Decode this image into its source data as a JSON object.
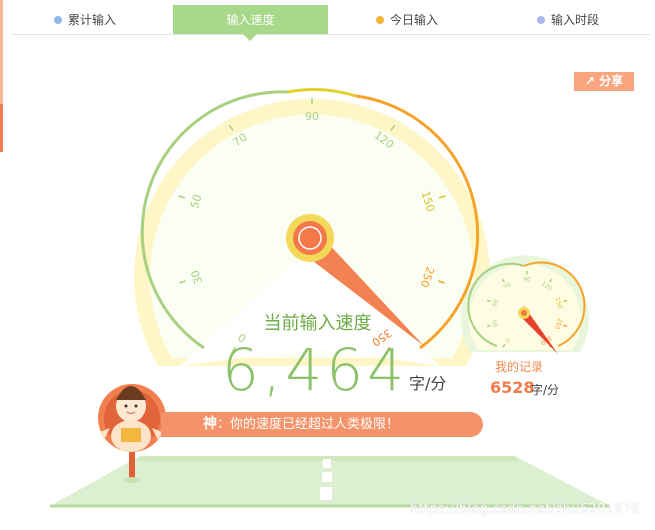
{
  "tabs": [
    {
      "label": "累计输入",
      "dot_color": "#8fb8ea"
    },
    {
      "label": "输入速度",
      "active": true
    },
    {
      "label": "今日输入",
      "dot_color": "#f7b234"
    },
    {
      "label": "输入时段",
      "dot_color": "#a9b8ee"
    }
  ],
  "share": {
    "label": "分享",
    "icon": "share-icon"
  },
  "gauge": {
    "ticks": [
      "0",
      "30",
      "50",
      "70",
      "90",
      "120",
      "150",
      "250",
      "350"
    ],
    "title": "当前输入速度",
    "value": "6,464",
    "unit": "字/分"
  },
  "record_gauge": {
    "ticks": [
      "0",
      "30",
      "50",
      "70",
      "90",
      "120",
      "150",
      "250",
      "350"
    ],
    "label": "我的记录",
    "value": "6528",
    "unit": "字/分"
  },
  "rank": {
    "title": "神",
    "separator": "：",
    "message": "你的速度已经超过人类极限！"
  },
  "watermark": "https://blog.csdn.net/zhu6201976",
  "colors": {
    "accent_green": "#a8d98a",
    "accent_orange": "#f07b4b",
    "gauge_outer": "#fff6c7"
  }
}
